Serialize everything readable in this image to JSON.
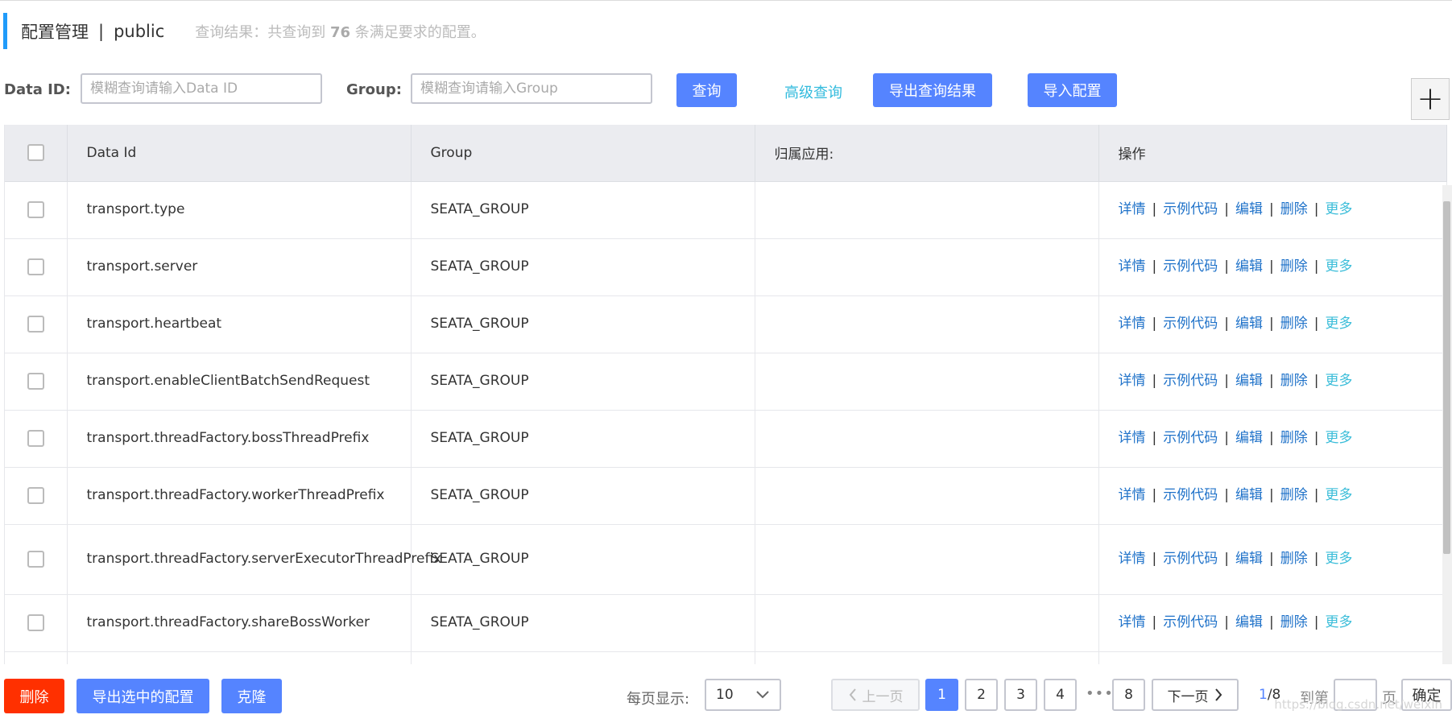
{
  "header": {
    "title": "配置管理",
    "separator": "|",
    "namespace": "public",
    "result_prefix": "查询结果：共查询到",
    "result_count": "76",
    "result_suffix": "条满足要求的配置。"
  },
  "search": {
    "data_id_label": "Data ID:",
    "data_id_placeholder": "模糊查询请输入Data ID",
    "data_id_value": "",
    "group_label": "Group:",
    "group_placeholder": "模糊查询请输入Group",
    "group_value": "",
    "query_button": "查询",
    "advanced_link": "高级查询",
    "export_button": "导出查询结果",
    "import_button": "导入配置",
    "add_icon": "plus-icon"
  },
  "table": {
    "columns": [
      "Data Id",
      "Group",
      "归属应用:",
      "操作"
    ],
    "rows": [
      {
        "data_id": "transport.type",
        "group": "SEATA_GROUP",
        "app": ""
      },
      {
        "data_id": "transport.server",
        "group": "SEATA_GROUP",
        "app": ""
      },
      {
        "data_id": "transport.heartbeat",
        "group": "SEATA_GROUP",
        "app": ""
      },
      {
        "data_id": "transport.enableClientBatchSendRequest",
        "group": "SEATA_GROUP",
        "app": ""
      },
      {
        "data_id": "transport.threadFactory.bossThreadPrefix",
        "group": "SEATA_GROUP",
        "app": ""
      },
      {
        "data_id": "transport.threadFactory.workerThreadPrefix",
        "group": "SEATA_GROUP",
        "app": ""
      },
      {
        "data_id": "transport.threadFactory.serverExecutorThreadPrefix",
        "group": "SEATA_GROUP",
        "app": ""
      },
      {
        "data_id": "transport.threadFactory.shareBossWorker",
        "group": "SEATA_GROUP",
        "app": ""
      },
      {
        "data_id": "",
        "group": "",
        "app": ""
      }
    ],
    "actions": {
      "detail": "详情",
      "sample": "示例代码",
      "edit": "编辑",
      "delete": "删除",
      "more": "更多",
      "separator": "|"
    }
  },
  "footer": {
    "delete_button": "删除",
    "export_selected_button": "导出选中的配置",
    "clone_button": "克隆",
    "per_page_label": "每页显示:",
    "per_page_value": "10",
    "prev_label": "上一页",
    "next_label": "下一页",
    "pages": [
      "1",
      "2",
      "3",
      "4",
      "8"
    ],
    "ellipsis": "•••",
    "current_page": "1",
    "total_pages": "/8",
    "goto_label": "到第",
    "goto_value": "",
    "page_unit": "页",
    "confirm_button": "确定"
  },
  "watermark": "https://blog.csdn.net/weixin",
  "colors": {
    "primary": "#5584ff",
    "danger": "#ff3000",
    "accent": "#209bfa",
    "link": "#1f72c9",
    "link_alt": "#3bbdd9"
  }
}
